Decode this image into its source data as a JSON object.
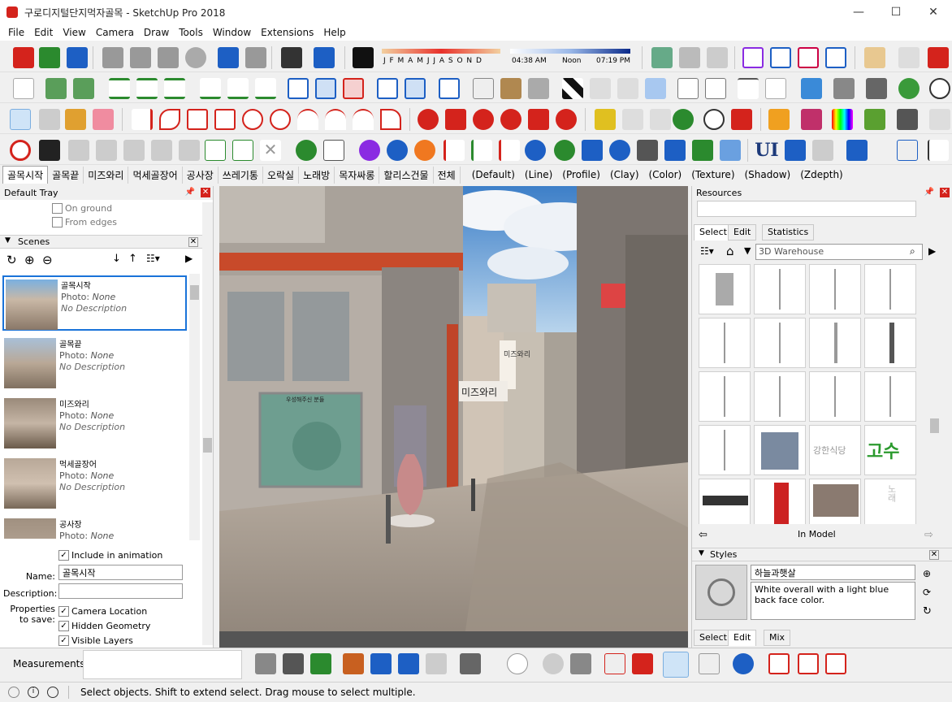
{
  "window": {
    "title": "구로디지털단지먹자골목 - SketchUp Pro 2018",
    "controls": {
      "minimize": "—",
      "maximize": "☐",
      "close": "✕"
    }
  },
  "menu": [
    "File",
    "Edit",
    "View",
    "Camera",
    "Draw",
    "Tools",
    "Window",
    "Extensions",
    "Help"
  ],
  "shadow": {
    "months": "J F M A M J J A S O N D",
    "time_start": "04:38 AM",
    "time_noon": "Noon",
    "time_end": "07:19 PM"
  },
  "toolbar_buttons": {
    "ui": "UI"
  },
  "scene_tabs": [
    "골목시작",
    "골목끝",
    "미즈와리",
    "먹세골장어",
    "공사장",
    "쓰레기통",
    "오락실",
    "노래방",
    "목자싸롱",
    "할리스건물",
    "전체"
  ],
  "style_tabs": [
    "(Default)",
    "(Line)",
    "(Profile)",
    "(Clay)",
    "(Color)",
    "(Texture)",
    "(Shadow)",
    "(Zdepth)"
  ],
  "left_tray": {
    "title": "Default Tray",
    "on_ground": "On ground",
    "from_edges": "From edges",
    "scenes_header": "Scenes",
    "scenes": [
      {
        "name": "골목시작",
        "photo": "Photo:",
        "photo_val": "None",
        "desc": "No Description"
      },
      {
        "name": "골목끝",
        "photo": "Photo:",
        "photo_val": "None",
        "desc": "No Description"
      },
      {
        "name": "미즈와리",
        "photo": "Photo:",
        "photo_val": "None",
        "desc": "No Description"
      },
      {
        "name": "먹세골장어",
        "photo": "Photo:",
        "photo_val": "None",
        "desc": "No Description"
      },
      {
        "name": "공사장",
        "photo": "Photo:",
        "photo_val": "None",
        "desc": ""
      }
    ],
    "include_anim": "Include in animation",
    "name_label": "Name:",
    "name_value": "골목시작",
    "desc_label": "Description:",
    "props_label": "Properties to save:",
    "camera_loc": "Camera Location",
    "hidden_geom": "Hidden Geometry",
    "visible_layers": "Visible Layers"
  },
  "viewport": {
    "sign_text": "우성해주신 분들",
    "shop_sign": "미즈와리",
    "shop_sign2": "미즈와리"
  },
  "right_tray": {
    "resources": "Resources",
    "tabs": [
      "Select",
      "Edit",
      "Statistics"
    ],
    "search_value": "3D Warehouse",
    "in_model": "In Model",
    "comp_texts": [
      "강한식당",
      "고수",
      "노래"
    ],
    "styles_header": "Styles",
    "style_name": "하늘과햇살",
    "style_desc": "White overall with a light blue back face color.",
    "style_tabs": [
      "Select",
      "Edit",
      "Mix"
    ]
  },
  "measurements": "Measurements",
  "status": "Select objects. Shift to extend select. Drag mouse to select multiple.",
  "colors": {
    "accent": "#1a73d9",
    "red": "#d4231c",
    "blue": "#1d5fc4",
    "green": "#1aa33a"
  }
}
